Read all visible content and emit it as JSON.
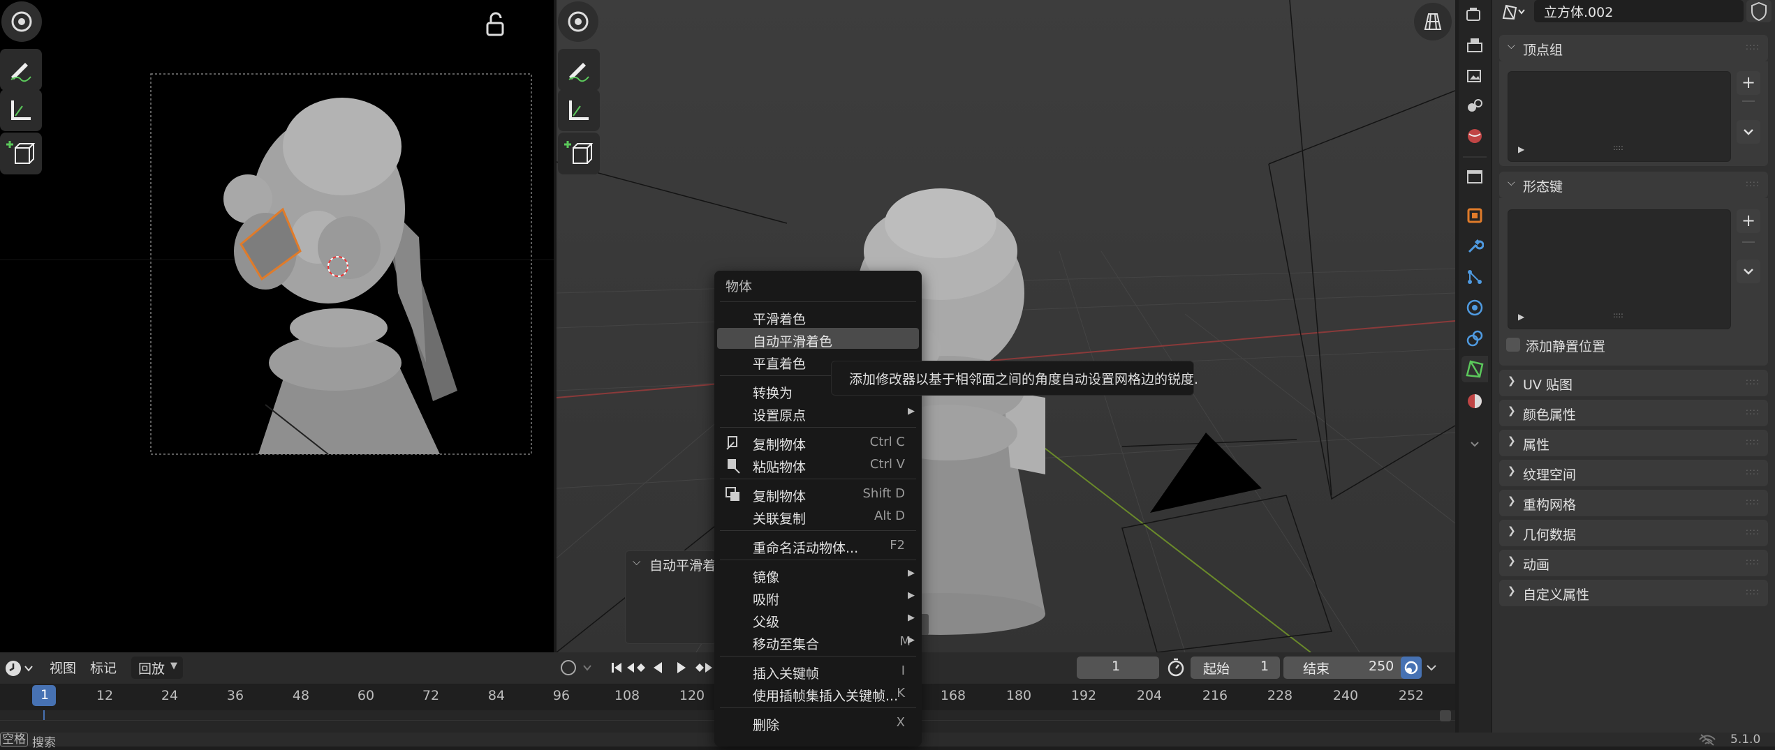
{
  "object_name": "立方体.002",
  "context_menu": {
    "title": "物体",
    "items": [
      {
        "label": "平滑着色",
        "shortcut": ""
      },
      {
        "label": "自动平滑着色",
        "shortcut": ""
      },
      {
        "label": "平直着色",
        "shortcut": ""
      },
      {
        "label": "转换为",
        "shortcut": ""
      },
      {
        "label": "设置原点",
        "shortcut": ""
      },
      {
        "label": "复制物体",
        "shortcut": "Ctrl C"
      },
      {
        "label": "粘贴物体",
        "shortcut": "Ctrl V"
      },
      {
        "label": "复制物体",
        "shortcut": "Shift D"
      },
      {
        "label": "关联复制",
        "shortcut": "Alt D"
      },
      {
        "label": "重命名活动物体...",
        "shortcut": "F2"
      },
      {
        "label": "镜像",
        "shortcut": ""
      },
      {
        "label": "吸附",
        "shortcut": ""
      },
      {
        "label": "父级",
        "shortcut": ""
      },
      {
        "label": "移动至集合",
        "shortcut": "M"
      },
      {
        "label": "插入关键帧",
        "shortcut": "I"
      },
      {
        "label": "使用插帧集插入关键帧...",
        "shortcut": "K"
      },
      {
        "label": "删除",
        "shortcut": "X"
      }
    ]
  },
  "tooltip": "添加修改器以基于相邻面之间的角度自动设置网格边的锐度.",
  "redo_panel": {
    "title": "自动平滑着色"
  },
  "timeline": {
    "menus": [
      "视图",
      "标记",
      "回放"
    ],
    "current_frame": "1",
    "start_label": "起始",
    "start_value": "1",
    "end_label": "结束",
    "end_value": "250",
    "ruler_marks": [
      "12",
      "24",
      "36",
      "48",
      "60",
      "72",
      "84",
      "96",
      "108",
      "120",
      "168",
      "180",
      "192",
      "204",
      "216",
      "228",
      "240",
      "252"
    ],
    "playhead_label": "1"
  },
  "status": {
    "key": "空格",
    "action": "搜索",
    "version": "5.1.0"
  },
  "properties": {
    "vertex_groups": "顶点组",
    "shape_keys": "形态键",
    "add_rest_position": "添加静置位置",
    "collapsed_panels": [
      "UV 贴图",
      "颜色属性",
      "属性",
      "纹理空间",
      "重构网格",
      "几何数据",
      "动画",
      "自定义属性"
    ]
  },
  "colors": {
    "accent": "#4772b3",
    "highlight": "#4b4b4b",
    "object_orange": "#e07b2a",
    "data_tab_green": "#5bc85b"
  }
}
